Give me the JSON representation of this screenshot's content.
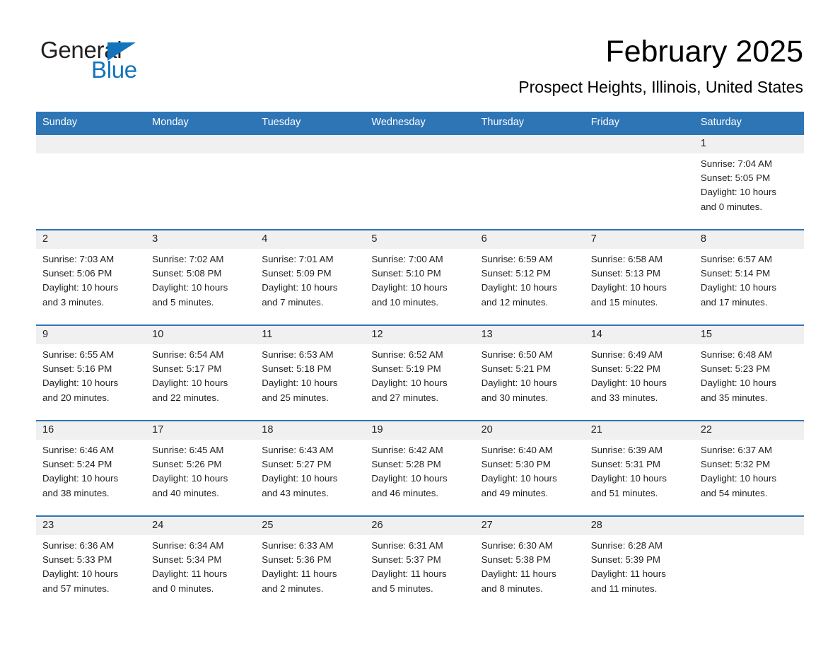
{
  "brand": {
    "name_part1": "General",
    "name_part2": "Blue",
    "triangle_color": "#1275bc"
  },
  "header": {
    "month_title": "February 2025",
    "location": "Prospect Heights, Illinois, United States"
  },
  "theme": {
    "header_blue": "#2e75b6",
    "daynum_band": "#f0f0f0",
    "text": "#231f20"
  },
  "weekday_headers": [
    "Sunday",
    "Monday",
    "Tuesday",
    "Wednesday",
    "Thursday",
    "Friday",
    "Saturday"
  ],
  "weeks": [
    [
      {
        "day": "",
        "sunrise": "",
        "sunset": "",
        "daylight": "",
        "daylight2": ""
      },
      {
        "day": "",
        "sunrise": "",
        "sunset": "",
        "daylight": "",
        "daylight2": ""
      },
      {
        "day": "",
        "sunrise": "",
        "sunset": "",
        "daylight": "",
        "daylight2": ""
      },
      {
        "day": "",
        "sunrise": "",
        "sunset": "",
        "daylight": "",
        "daylight2": ""
      },
      {
        "day": "",
        "sunrise": "",
        "sunset": "",
        "daylight": "",
        "daylight2": ""
      },
      {
        "day": "",
        "sunrise": "",
        "sunset": "",
        "daylight": "",
        "daylight2": ""
      },
      {
        "day": "1",
        "sunrise": "Sunrise: 7:04 AM",
        "sunset": "Sunset: 5:05 PM",
        "daylight": "Daylight: 10 hours",
        "daylight2": "and 0 minutes."
      }
    ],
    [
      {
        "day": "2",
        "sunrise": "Sunrise: 7:03 AM",
        "sunset": "Sunset: 5:06 PM",
        "daylight": "Daylight: 10 hours",
        "daylight2": "and 3 minutes."
      },
      {
        "day": "3",
        "sunrise": "Sunrise: 7:02 AM",
        "sunset": "Sunset: 5:08 PM",
        "daylight": "Daylight: 10 hours",
        "daylight2": "and 5 minutes."
      },
      {
        "day": "4",
        "sunrise": "Sunrise: 7:01 AM",
        "sunset": "Sunset: 5:09 PM",
        "daylight": "Daylight: 10 hours",
        "daylight2": "and 7 minutes."
      },
      {
        "day": "5",
        "sunrise": "Sunrise: 7:00 AM",
        "sunset": "Sunset: 5:10 PM",
        "daylight": "Daylight: 10 hours",
        "daylight2": "and 10 minutes."
      },
      {
        "day": "6",
        "sunrise": "Sunrise: 6:59 AM",
        "sunset": "Sunset: 5:12 PM",
        "daylight": "Daylight: 10 hours",
        "daylight2": "and 12 minutes."
      },
      {
        "day": "7",
        "sunrise": "Sunrise: 6:58 AM",
        "sunset": "Sunset: 5:13 PM",
        "daylight": "Daylight: 10 hours",
        "daylight2": "and 15 minutes."
      },
      {
        "day": "8",
        "sunrise": "Sunrise: 6:57 AM",
        "sunset": "Sunset: 5:14 PM",
        "daylight": "Daylight: 10 hours",
        "daylight2": "and 17 minutes."
      }
    ],
    [
      {
        "day": "9",
        "sunrise": "Sunrise: 6:55 AM",
        "sunset": "Sunset: 5:16 PM",
        "daylight": "Daylight: 10 hours",
        "daylight2": "and 20 minutes."
      },
      {
        "day": "10",
        "sunrise": "Sunrise: 6:54 AM",
        "sunset": "Sunset: 5:17 PM",
        "daylight": "Daylight: 10 hours",
        "daylight2": "and 22 minutes."
      },
      {
        "day": "11",
        "sunrise": "Sunrise: 6:53 AM",
        "sunset": "Sunset: 5:18 PM",
        "daylight": "Daylight: 10 hours",
        "daylight2": "and 25 minutes."
      },
      {
        "day": "12",
        "sunrise": "Sunrise: 6:52 AM",
        "sunset": "Sunset: 5:19 PM",
        "daylight": "Daylight: 10 hours",
        "daylight2": "and 27 minutes."
      },
      {
        "day": "13",
        "sunrise": "Sunrise: 6:50 AM",
        "sunset": "Sunset: 5:21 PM",
        "daylight": "Daylight: 10 hours",
        "daylight2": "and 30 minutes."
      },
      {
        "day": "14",
        "sunrise": "Sunrise: 6:49 AM",
        "sunset": "Sunset: 5:22 PM",
        "daylight": "Daylight: 10 hours",
        "daylight2": "and 33 minutes."
      },
      {
        "day": "15",
        "sunrise": "Sunrise: 6:48 AM",
        "sunset": "Sunset: 5:23 PM",
        "daylight": "Daylight: 10 hours",
        "daylight2": "and 35 minutes."
      }
    ],
    [
      {
        "day": "16",
        "sunrise": "Sunrise: 6:46 AM",
        "sunset": "Sunset: 5:24 PM",
        "daylight": "Daylight: 10 hours",
        "daylight2": "and 38 minutes."
      },
      {
        "day": "17",
        "sunrise": "Sunrise: 6:45 AM",
        "sunset": "Sunset: 5:26 PM",
        "daylight": "Daylight: 10 hours",
        "daylight2": "and 40 minutes."
      },
      {
        "day": "18",
        "sunrise": "Sunrise: 6:43 AM",
        "sunset": "Sunset: 5:27 PM",
        "daylight": "Daylight: 10 hours",
        "daylight2": "and 43 minutes."
      },
      {
        "day": "19",
        "sunrise": "Sunrise: 6:42 AM",
        "sunset": "Sunset: 5:28 PM",
        "daylight": "Daylight: 10 hours",
        "daylight2": "and 46 minutes."
      },
      {
        "day": "20",
        "sunrise": "Sunrise: 6:40 AM",
        "sunset": "Sunset: 5:30 PM",
        "daylight": "Daylight: 10 hours",
        "daylight2": "and 49 minutes."
      },
      {
        "day": "21",
        "sunrise": "Sunrise: 6:39 AM",
        "sunset": "Sunset: 5:31 PM",
        "daylight": "Daylight: 10 hours",
        "daylight2": "and 51 minutes."
      },
      {
        "day": "22",
        "sunrise": "Sunrise: 6:37 AM",
        "sunset": "Sunset: 5:32 PM",
        "daylight": "Daylight: 10 hours",
        "daylight2": "and 54 minutes."
      }
    ],
    [
      {
        "day": "23",
        "sunrise": "Sunrise: 6:36 AM",
        "sunset": "Sunset: 5:33 PM",
        "daylight": "Daylight: 10 hours",
        "daylight2": "and 57 minutes."
      },
      {
        "day": "24",
        "sunrise": "Sunrise: 6:34 AM",
        "sunset": "Sunset: 5:34 PM",
        "daylight": "Daylight: 11 hours",
        "daylight2": "and 0 minutes."
      },
      {
        "day": "25",
        "sunrise": "Sunrise: 6:33 AM",
        "sunset": "Sunset: 5:36 PM",
        "daylight": "Daylight: 11 hours",
        "daylight2": "and 2 minutes."
      },
      {
        "day": "26",
        "sunrise": "Sunrise: 6:31 AM",
        "sunset": "Sunset: 5:37 PM",
        "daylight": "Daylight: 11 hours",
        "daylight2": "and 5 minutes."
      },
      {
        "day": "27",
        "sunrise": "Sunrise: 6:30 AM",
        "sunset": "Sunset: 5:38 PM",
        "daylight": "Daylight: 11 hours",
        "daylight2": "and 8 minutes."
      },
      {
        "day": "28",
        "sunrise": "Sunrise: 6:28 AM",
        "sunset": "Sunset: 5:39 PM",
        "daylight": "Daylight: 11 hours",
        "daylight2": "and 11 minutes."
      },
      {
        "day": "",
        "sunrise": "",
        "sunset": "",
        "daylight": "",
        "daylight2": ""
      }
    ]
  ]
}
